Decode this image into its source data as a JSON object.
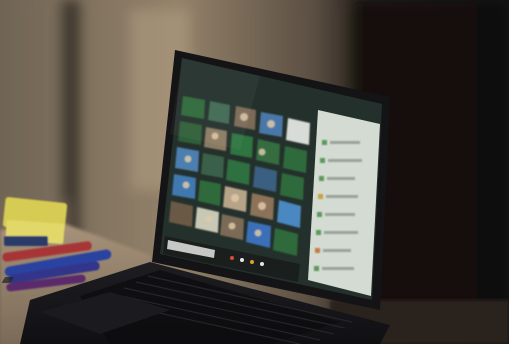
{
  "scene": {
    "subject": "laptop-showing-video-conference",
    "colors": {
      "wall_light": "#8f7e66",
      "wall_dark": "#1a1512",
      "desk": "#b9a48a",
      "laptop_body": "#161618",
      "screen_bg": "#27302c",
      "sidebar": "#d9dfd9",
      "tile_green": "#2f6a3a",
      "tile_blue": "#3a5f80",
      "tile_warm": "#7a6450",
      "sticky_note": "#d8cf55",
      "marker_blue": "#2a3d8c",
      "marker_red": "#a03030"
    }
  }
}
